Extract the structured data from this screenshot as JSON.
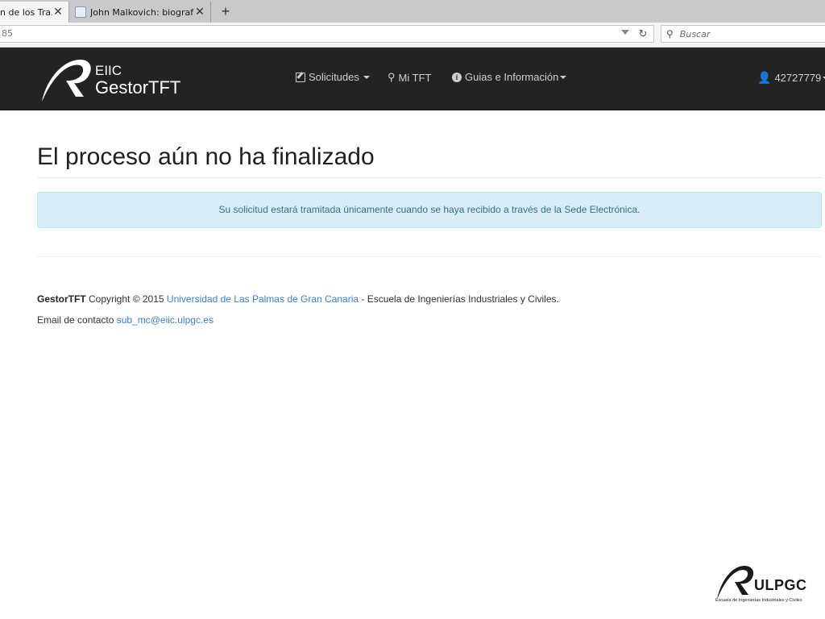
{
  "browser": {
    "tabs": [
      {
        "title": "n de los Tra...",
        "active": true
      },
      {
        "title": "John Malkovich: biografía ...",
        "active": false
      }
    ],
    "new_tab_label": "+",
    "close_glyph": "✕",
    "url": "85",
    "search_placeholder": "Buscar"
  },
  "navbar": {
    "brand_line1": "EIIC",
    "brand_line2": "GestorTFT",
    "items": [
      {
        "label": "Solicitudes",
        "icon": "edit-icon",
        "dropdown": true
      },
      {
        "label": "Mi TFT",
        "icon": "search-icon",
        "dropdown": false
      },
      {
        "label": "Guias e Información",
        "icon": "info-icon",
        "dropdown": true
      }
    ],
    "user": {
      "label": "42727779",
      "icon": "user-icon",
      "dropdown": true
    },
    "background": "#232323",
    "text_color": "#cfcfcf"
  },
  "main": {
    "title": "El proceso aún no ha finalizado",
    "alert": "Su solicitud estará tramitada únicamente cuando se haya recibido a través de la Sede Electrónica.",
    "alert_bg": "#d9edf7",
    "alert_color": "#31708f"
  },
  "footer": {
    "brand": "GestorTFT",
    "copyright": " Copyright © 2015 ",
    "university_link": "Universidad de Las Palmas de Gran Canaria",
    "separator": " - ",
    "school": "Escuela de Ingenierías Industriales y Civiles.",
    "contact_label": "Email de contacto ",
    "contact_email": "sub_mc@eiic.ulpgc.es",
    "link_color": "#3b7fc4"
  },
  "corner_logo": {
    "wordmark": "ULPGC",
    "subtitle": "Escuela de Ingenierías Industriales y Civiles"
  }
}
